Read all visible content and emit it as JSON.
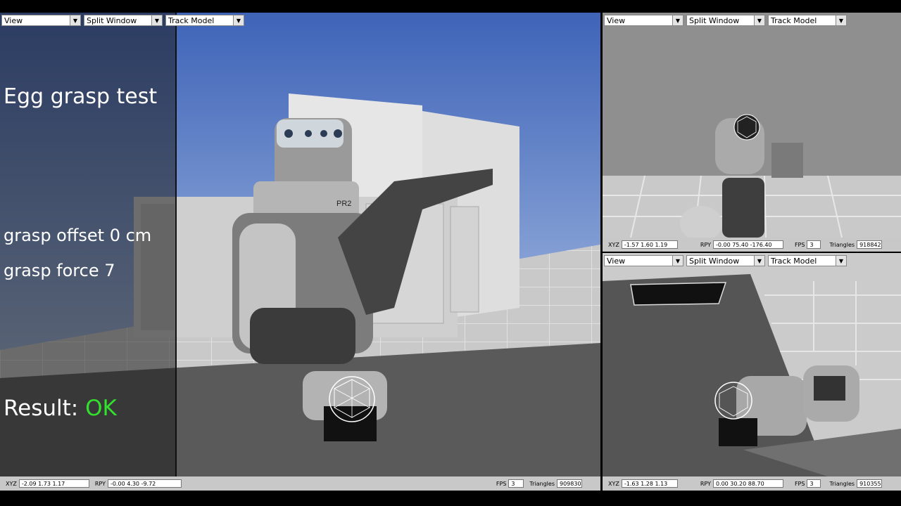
{
  "toolbar": {
    "view_label": "View",
    "split_label": "Split Window",
    "track_label": "Track Model"
  },
  "overlay": {
    "title": "Egg grasp test",
    "offset": "grasp offset 0 cm",
    "force": "grasp force 7",
    "result_label": "Result:",
    "result_value": "OK",
    "result_color": "#33e02d"
  },
  "robot": {
    "label": "PR2"
  },
  "status_labels": {
    "xyz": "XYZ",
    "rpy": "RPY",
    "fps": "FPS",
    "triangles": "Triangles"
  },
  "views": {
    "main": {
      "xyz": "-2.09   1.73   1.17",
      "rpy": "-0.00   4.30   -9.72",
      "fps": "3",
      "triangles": "909830"
    },
    "top_right": {
      "xyz": "-1.57   1.60   1.19",
      "rpy": "-0.00   75.40 -176.40",
      "fps": "3",
      "triangles": "918842"
    },
    "bottom_right": {
      "xyz": "-1.63   1.28   1.13",
      "rpy": "0.00   30.20   88.70",
      "fps": "3",
      "triangles": "910355"
    }
  }
}
